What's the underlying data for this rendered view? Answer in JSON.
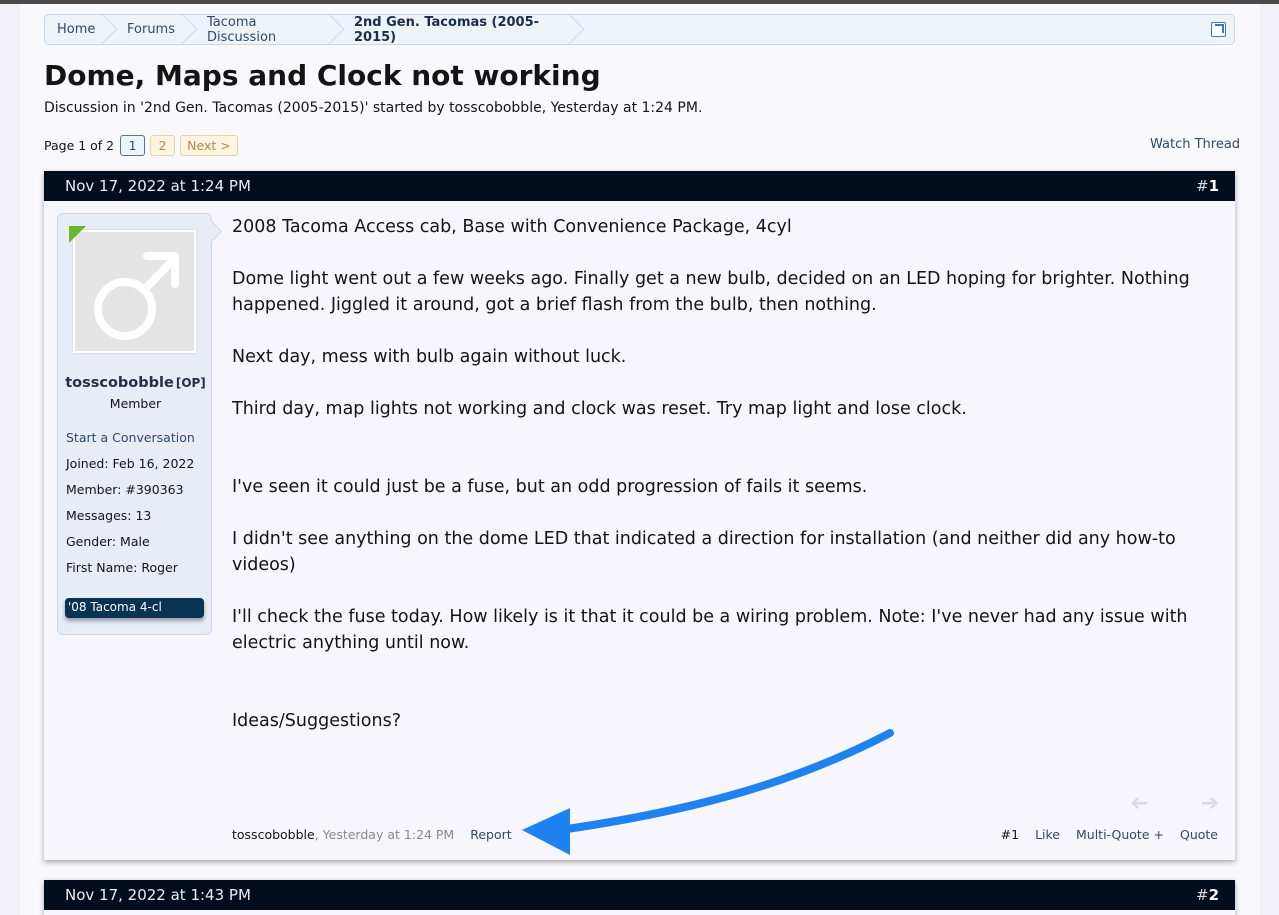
{
  "breadcrumb": {
    "items": [
      "Home",
      "Forums",
      "Tacoma Discussion",
      "2nd Gen. Tacomas (2005-2015)"
    ]
  },
  "thread": {
    "title": "Dome, Maps and Clock not working",
    "subtitle": "Discussion in '2nd Gen. Tacomas (2005-2015)' started by tosscobobble, Yesterday at 1:24 PM."
  },
  "pagenav": {
    "label": "Page 1 of 2",
    "pages": [
      "1",
      "2"
    ],
    "next": "Next >"
  },
  "watch_label": "Watch Thread",
  "post1": {
    "date": "Nov 17, 2022 at 1:24 PM",
    "hash": "#",
    "number": "1",
    "user": {
      "name": "tosscobobble",
      "op": "[OP]",
      "title": "Member",
      "start_conversation": "Start a Conversation",
      "joined": "Joined:  Feb 16, 2022",
      "member": "Member:  #390363",
      "messages": "Messages:  13",
      "gender": "Gender:  Male",
      "first_name": "First Name:  Roger",
      "banner": "'08 Tacoma 4-cl"
    },
    "paragraphs": [
      "2008 Tacoma Access cab, Base with Convenience Package, 4cyl",
      "Dome light went out a few weeks ago. Finally get a new bulb, decided on an LED hoping for brighter. Nothing happened. Jiggled it around, got a brief flash from the bulb, then nothing.",
      "Next day, mess with bulb again without luck.",
      "Third day, map lights not working and clock was reset. Try map light and lose clock.",
      "I've seen it could just be a fuse, but an odd progression of fails it seems.",
      "I didn't see anything on the dome LED that indicated a direction for installation (and neither did any how-to videos)",
      "I'll check the fuse today. How likely is it that it could be a wiring problem. Note: I've never had any issue with electric anything until now.",
      "Ideas/Suggestions?"
    ],
    "footer": {
      "author": "tosscobobble",
      "date": ", Yesterday at 1:24 PM",
      "report": "Report",
      "num": "#1",
      "like": "Like",
      "multiquote": "Multi-Quote +",
      "quote": "Quote"
    }
  },
  "post2": {
    "date": "Nov 17, 2022 at 1:43 PM",
    "hash": "#",
    "number": "2"
  },
  "colors": {
    "header_bg": "#010c1c",
    "link": "#32486a",
    "annotation_arrow": "#1e82f0",
    "online_badge": "#6cb52d",
    "banner_bg": "#083353"
  },
  "icons": [
    "external-link-icon",
    "male-symbol-icon",
    "arrow-left-icon",
    "arrow-right-icon",
    "annotation-arrow"
  ]
}
